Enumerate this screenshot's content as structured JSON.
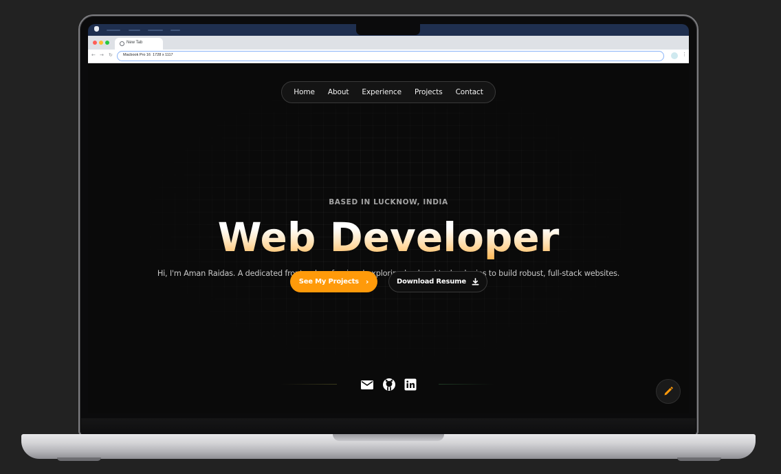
{
  "browser": {
    "tab_title": "New Tab",
    "address_value": "Macbook Pro 16  1728 x 1117"
  },
  "colors": {
    "accent": "#ff9a0a",
    "background": "#0a0a0a",
    "menubar": "#1f2f4f"
  },
  "nav": {
    "links": [
      "Home",
      "About",
      "Experience",
      "Projects",
      "Contact"
    ]
  },
  "hero": {
    "eyebrow": "BASED IN LUCKNOW, INDIA",
    "headline": "Web Developer",
    "intro": "Hi, I'm Aman Raidas. A dedicated frontend professional exploring backend technologies to build robust, full-stack websites.",
    "primary_cta": "See My Projects",
    "secondary_cta": "Download Resume"
  },
  "social": {
    "icons": [
      "mail-icon",
      "github-icon",
      "linkedin-icon"
    ]
  },
  "fab": {
    "icon": "pencil-icon"
  }
}
